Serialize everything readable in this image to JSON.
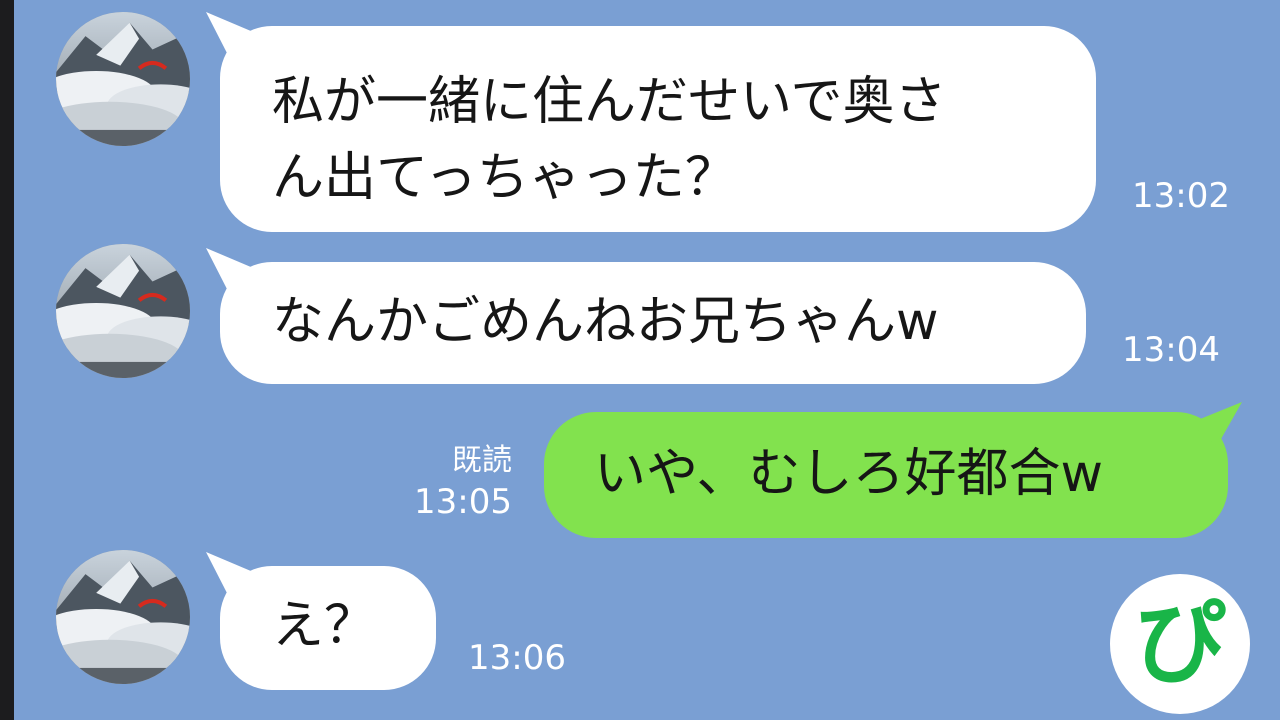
{
  "messages": [
    {
      "direction": "incoming",
      "text": "私が一緒に住んだせいで奥さ\nん出てっちゃった？",
      "time": "13:02"
    },
    {
      "direction": "incoming",
      "text": "なんかごめんねお兄ちゃんw",
      "time": "13:04"
    },
    {
      "direction": "outgoing",
      "text": "いや、むしろ好都合w",
      "time": "13:05",
      "read": "既読"
    },
    {
      "direction": "incoming",
      "text": "え？",
      "time": "13:06"
    }
  ],
  "logo_text": "ぴ",
  "colors": {
    "background": "#7a9fd3",
    "incoming_bubble": "#ffffff",
    "outgoing_bubble": "#82e24e",
    "logo": "#19b548"
  }
}
